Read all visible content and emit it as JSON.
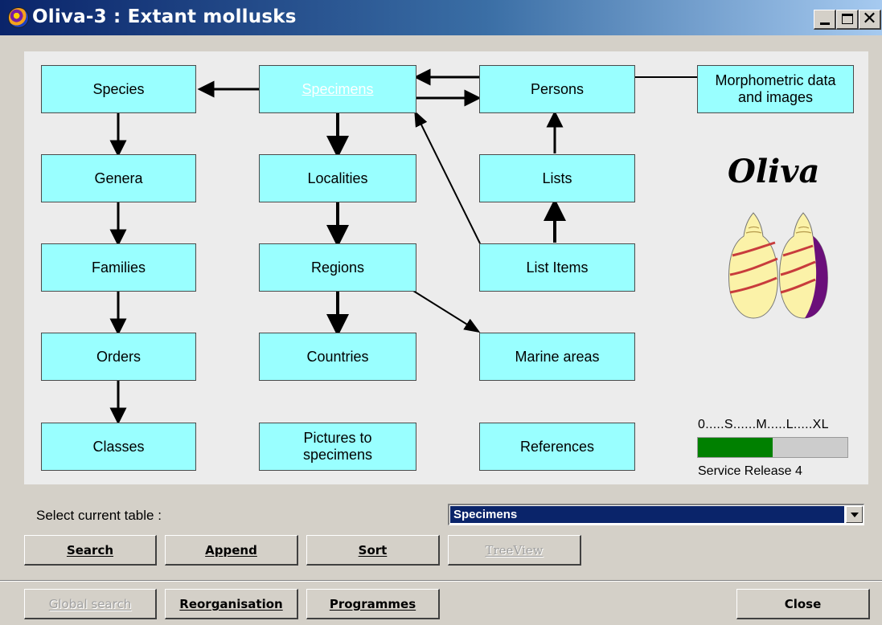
{
  "window": {
    "title": "Oliva-3 : Extant mollusks",
    "close_glyph": "✕"
  },
  "diagram": {
    "tables": {
      "species": "Species",
      "specimens": "Specimens",
      "persons": "Persons",
      "morphometric": [
        "Morphometric data",
        "and images"
      ],
      "genera": "Genera",
      "localities": "Localities",
      "lists": "Lists",
      "families": "Families",
      "regions": "Regions",
      "list_items": "List Items",
      "orders": "Orders",
      "countries": "Countries",
      "marine_areas": "Marine areas",
      "classes": "Classes",
      "pictures": [
        "Pictures to",
        "specimens"
      ],
      "references": "References"
    },
    "active_table": "Specimens",
    "logo_text": "Oliva",
    "size_scale_label": "0.....S......M.....L.....XL",
    "size_level_fraction": 0.5,
    "release_label": "Service Release 4"
  },
  "controls": {
    "select_label": "Select current table :",
    "selected_table": "Specimens"
  },
  "buttons": {
    "search": "Search",
    "append": "Append",
    "sort": "Sort",
    "treeview": "TreeView",
    "global_search": "Global search",
    "reorganisation": "Reorganisation",
    "programmes": "Programmes",
    "close": "Close"
  },
  "colors": {
    "box_fill": "#99ffff",
    "size_bar": "#008000",
    "selection": "#0a246a",
    "shell_band": "#c83c3c",
    "shell_purple": "#6b0f7a"
  }
}
